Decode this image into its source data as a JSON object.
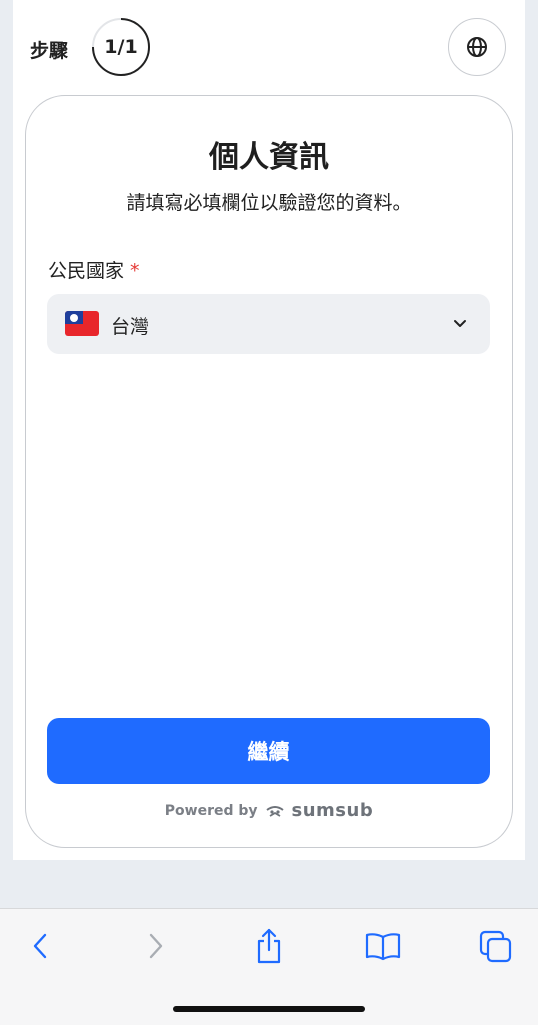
{
  "header": {
    "step_label": "步驟",
    "step_count": "1/1",
    "language_icon": "globe-icon"
  },
  "form": {
    "title": "個人資訊",
    "subtitle": "請填寫必填欄位以驗證您的資料。",
    "citizenship": {
      "label": "公民國家",
      "required_mark": "*",
      "selected_value": "台灣",
      "flag_icon": "taiwan-flag-icon"
    },
    "continue_label": "繼續"
  },
  "footer": {
    "powered_by": "Powered by",
    "brand": "sumsub"
  },
  "toolbar": {
    "back_icon": "chevron-left-icon",
    "forward_icon": "chevron-right-icon",
    "share_icon": "share-icon",
    "bookmarks_icon": "book-icon",
    "tabs_icon": "tabs-icon"
  },
  "colors": {
    "accent": "#1f6bff",
    "required": "#e53935",
    "background": "#e9edf2"
  }
}
